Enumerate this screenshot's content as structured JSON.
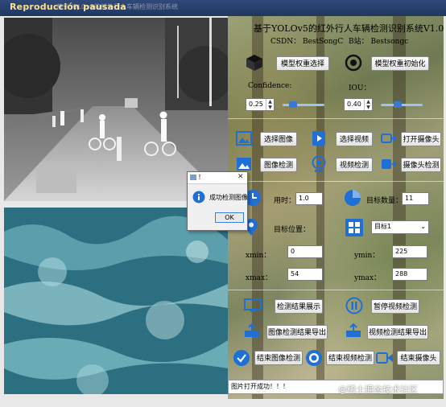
{
  "window": {
    "title": "Reproducción pausada",
    "bg_title_fragment": "基于YOLOv5的红外行人车辆检测识别系统"
  },
  "header": {
    "title": "基于YOLOv5的红外行人车辆检测识别系统V1.0",
    "csdn": "CSDN：   BestSongC",
    "bilibili": "B站：  Bestsongc"
  },
  "model": {
    "select_weights": "模型权重选择",
    "init_weights": "模型权重初始化"
  },
  "params": {
    "confidence_label": "Confidence:",
    "confidence_value": "0.25",
    "confidence_level": 0.25,
    "iou_label": "IOU：",
    "iou_value": "0.40",
    "iou_level": 0.4
  },
  "inputs": {
    "select_image": "选择图像",
    "select_video": "选择视频",
    "open_camera": "打开摄像头",
    "image_detect": "图像检测",
    "video_detect": "视频检测",
    "camera_detect": "摄像头检测"
  },
  "results": {
    "time_label": "用时：",
    "time_value": "1.0",
    "count_label": "目标数量：",
    "count_value": "11",
    "position_label": "目标位置：",
    "target_select": "目标1",
    "xmin_label": "xmin：",
    "xmin_value": "0",
    "ymin_label": "ymin：",
    "ymin_value": "225",
    "xmax_label": "xmax：",
    "xmax_value": "54",
    "ymax_label": "ymax：",
    "ymax_value": "288"
  },
  "actions": {
    "show_result": "检测结果展示",
    "pause_video": "暂停视频检测",
    "export_image": "图像检测结果导出",
    "export_video": "视频检测结果导出",
    "end_image": "结束图像检测",
    "end_video": "结束视频检测",
    "end_camera": "结束摄像头"
  },
  "status": {
    "text": "图片打开成功！！！"
  },
  "watermark": "@稀土掘金技术社区",
  "dialog": {
    "title": "！",
    "message": "成功检测图像",
    "ok": "OK"
  },
  "colors": {
    "icon_blue": "#1f6fd6",
    "accent": "#3a78d6",
    "ir_image_bg": "#7c7c7c",
    "water_image_bg": "#2c6f80"
  },
  "icons": {
    "model_select": "cube-icon",
    "model_init": "target-gear-icon",
    "select_image": "image-icon",
    "select_video": "video-file-icon",
    "open_camera": "camera-icon",
    "image_detect": "image-detect-icon",
    "video_detect": "webcam-icon",
    "camera_detect": "video-camera-icon",
    "time": "clock-icon",
    "count": "pie-chart-icon",
    "position": "location-icon",
    "target": "grid-icon",
    "show_result": "display-icon",
    "pause_video": "pause-icon",
    "export_image": "export-icon",
    "export_video": "export-icon",
    "end_image": "check-circle-icon",
    "end_video": "stop-circle-icon",
    "end_camera": "camera-stop-icon",
    "dialog_info": "info-icon"
  }
}
